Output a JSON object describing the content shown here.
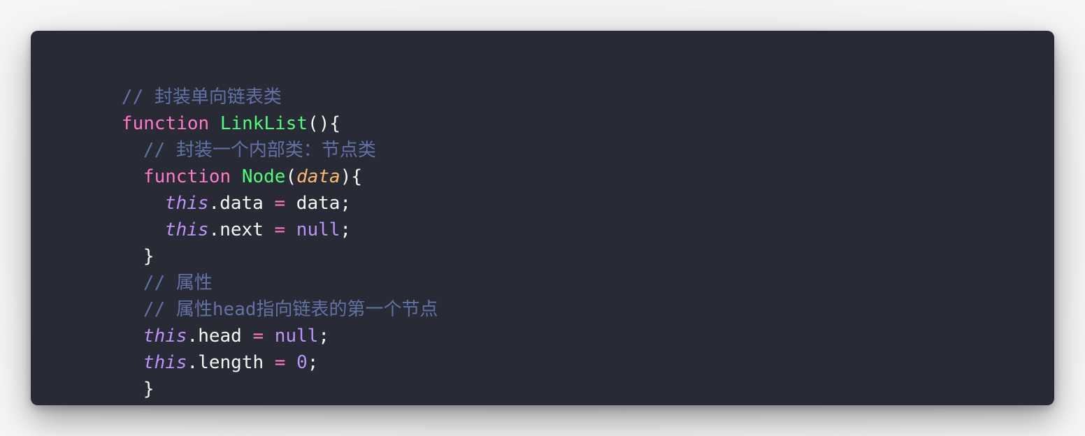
{
  "code": {
    "comment_1": "// 封装单向链表类",
    "kw_function": "function",
    "fn_linklist": "LinkList",
    "paren_open_brace": "(){",
    "comment_2": "// 封装一个内部类：节点类",
    "fn_node": "Node",
    "paren_open": "(",
    "param_data": "data",
    "paren_close_brace": "){",
    "this_kw": "this",
    "prop_data": ".data",
    "assign": "=",
    "value_data": "data;",
    "prop_next": ".next",
    "null_kw": "null",
    "semicolon": ";",
    "close_brace": "}",
    "comment_3": "// 属性",
    "comment_4": "// 属性head指向链表的第一个节点",
    "prop_head": ".head",
    "prop_length": ".length",
    "zero": "0"
  },
  "colors": {
    "background": "#282a36",
    "comment": "#6272a4",
    "keyword": "#ff79c6",
    "function_name": "#50fa7b",
    "parameter": "#ffb86c",
    "this_and_constants": "#bd93f9",
    "plain_text": "#f8f8f2"
  }
}
